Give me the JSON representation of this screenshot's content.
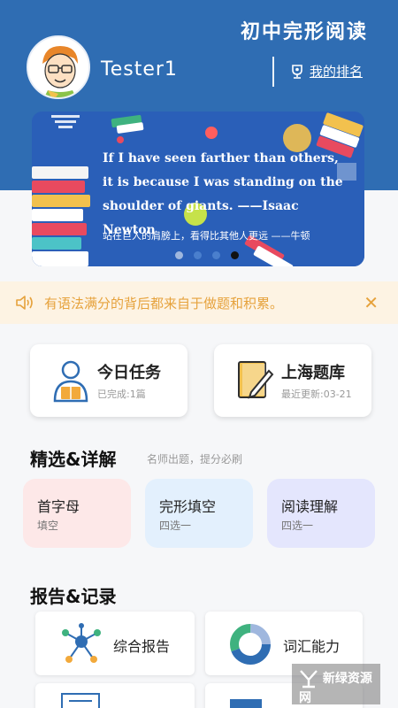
{
  "header": {
    "app_title": "初中完形阅读",
    "username": "Tester1",
    "rank_label": "我的排名"
  },
  "banner": {
    "quote_en": "If I have seen farther than others, it is because I was standing on the shoulder of giants.   ——Isaac Newton",
    "quote_zh": "站在巨人的肩膀上，看得比其他人更远  ——牛顿",
    "slide_count": 4,
    "active_slide": 4
  },
  "notice": {
    "text": "有语法满分的背后都来自于做题和积累。"
  },
  "cards": [
    {
      "title": "今日任务",
      "subtitle": "已完成:1篇"
    },
    {
      "title": "上海题库",
      "subtitle": "最近更新:03-21"
    }
  ],
  "featured": {
    "title": "精选&详解",
    "subtitle": "名师出题，提分必刷",
    "items": [
      {
        "title": "首字母",
        "subtitle": "填空",
        "color": "#fde8e8"
      },
      {
        "title": "完形填空",
        "subtitle": "四选一",
        "color": "#e3f0fd"
      },
      {
        "title": "阅读理解",
        "subtitle": "四选一",
        "color": "#e4e6fd"
      }
    ]
  },
  "reports": {
    "title": "报告&记录",
    "items": [
      {
        "label": "综合报告",
        "icon": "network-icon"
      },
      {
        "label": "词汇能力",
        "icon": "donut-chart-icon"
      }
    ]
  },
  "watermark": {
    "text": "新绿资源网"
  },
  "colors": {
    "header_blue": "#2f6db3",
    "notice_orange": "#e6a23c",
    "notice_bg": "#fdf3e3"
  }
}
